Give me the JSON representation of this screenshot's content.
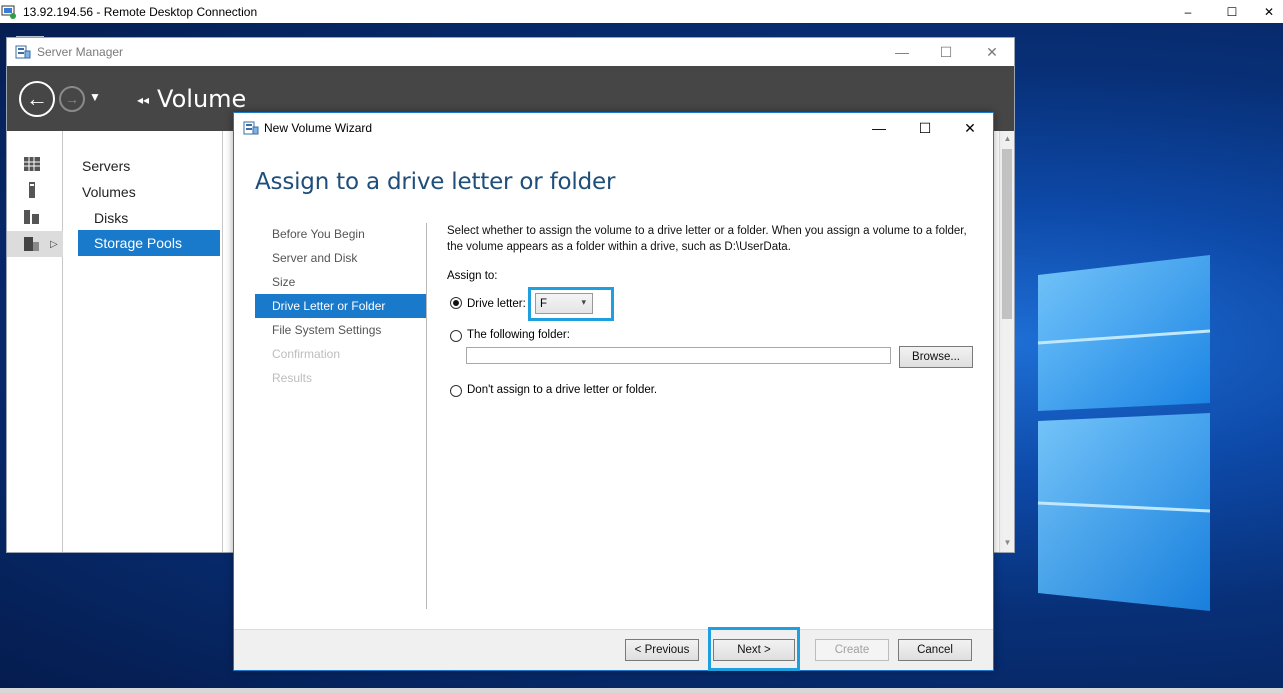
{
  "rdc": {
    "title": "13.92.194.56 - Remote Desktop Connection",
    "min": "–",
    "max": "☐",
    "close": "✕"
  },
  "server_manager": {
    "title": "Server Manager",
    "breadcrumb": "Volume",
    "breadcrumb_arrow": "◂◂",
    "min": "—",
    "max": "☐",
    "close": "✕",
    "nav_items": [
      "Servers",
      "Volumes",
      "Disks",
      "Storage Pools"
    ]
  },
  "wizard": {
    "title": "New Volume Wizard",
    "min": "—",
    "max": "☐",
    "close": "✕",
    "heading": "Assign to a drive letter or folder",
    "steps": [
      {
        "label": "Before You Begin",
        "state": "normal"
      },
      {
        "label": "Server and Disk",
        "state": "normal"
      },
      {
        "label": "Size",
        "state": "normal"
      },
      {
        "label": "Drive Letter or Folder",
        "state": "active"
      },
      {
        "label": "File System Settings",
        "state": "normal"
      },
      {
        "label": "Confirmation",
        "state": "disabled"
      },
      {
        "label": "Results",
        "state": "disabled"
      }
    ],
    "description": "Select whether to assign the volume to a drive letter or a folder. When you assign a volume to a folder, the volume appears as a folder within a drive, such as D:\\UserData.",
    "assign_to_label": "Assign to:",
    "option_drive_letter": "Drive letter:",
    "drive_letter_value": "F",
    "option_folder": "The following folder:",
    "folder_value": "",
    "browse_label": "Browse...",
    "option_none": "Don't assign to a drive letter or folder.",
    "selected_option": "drive_letter",
    "buttons": {
      "previous": "< Previous",
      "next": "Next >",
      "create": "Create",
      "cancel": "Cancel"
    }
  },
  "colors": {
    "accent": "#1979ca",
    "highlight": "#1ea0e0",
    "heading": "#1e4e79"
  }
}
